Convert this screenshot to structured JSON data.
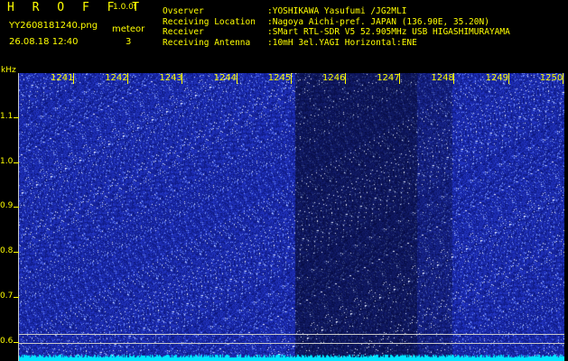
{
  "header": {
    "app_name": "H R O F F T",
    "version": "1.0.0f",
    "file_name": "YY2608181240.png",
    "meteor_label": "meteor",
    "date_time": "26.08.18 12:40",
    "meteor_count": "3"
  },
  "info": [
    {
      "key": "Ovserver",
      "value": ":YOSHIKAWA Yasufumi /JG2MLI"
    },
    {
      "key": "Receiving Location",
      "value": ":Nagoya Aichi-pref. JAPAN (136.90E, 35.20N)"
    },
    {
      "key": "Receiver",
      "value": ":SMart RTL-SDR V5 52.905MHz USB HIGASHIMURAYAMA"
    },
    {
      "key": "Receiving Antenna",
      "value": ":10mH 3el.YAGI Horizontal:ENE"
    }
  ],
  "spectrogram": {
    "y_unit": "kHz",
    "y_ticks": [
      "1.1",
      "1.0",
      "0.9",
      "0.8",
      "0.7",
      "0.6"
    ],
    "x_ticks": [
      "1241",
      "1242",
      "1243",
      "1244",
      "1245",
      "1246",
      "1247",
      "1248",
      "1249",
      "1250"
    ],
    "colors": {
      "label": "#ffff00",
      "background": "#0b1ba8",
      "noise": "#ffffff",
      "carrier": "#00e5ff"
    }
  }
}
